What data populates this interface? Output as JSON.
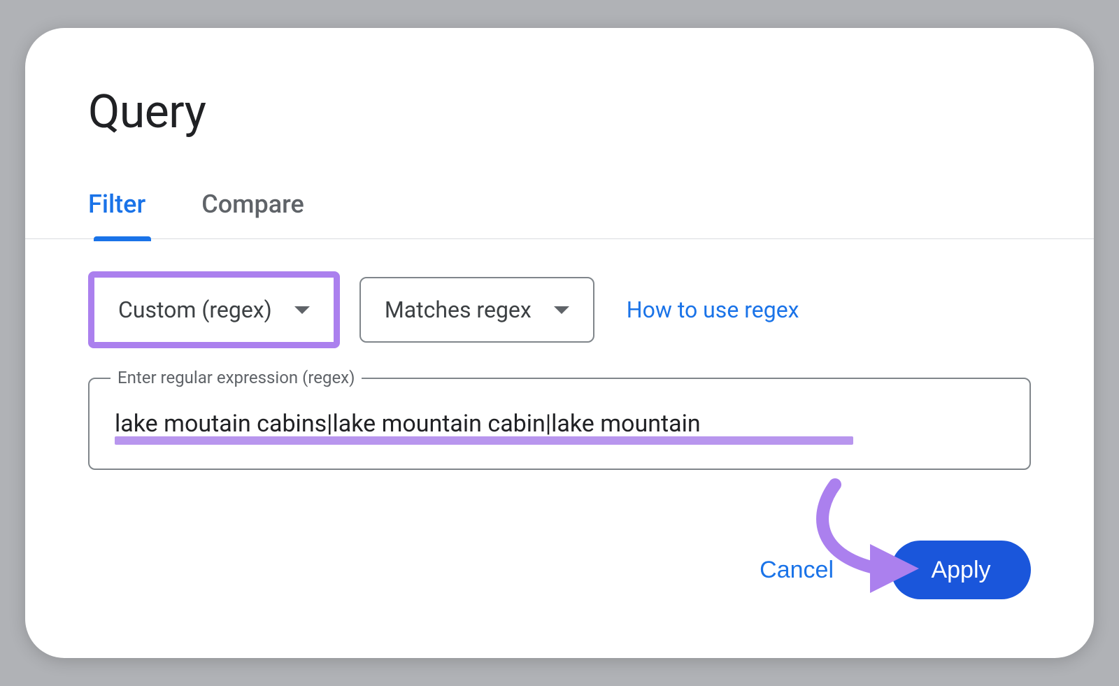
{
  "dialog": {
    "title": "Query"
  },
  "tabs": {
    "filter": "Filter",
    "compare": "Compare"
  },
  "controls": {
    "type_dropdown": "Custom (regex)",
    "match_dropdown": "Matches regex",
    "help_link": "How to use regex"
  },
  "field": {
    "legend": "Enter regular expression (regex)",
    "value": "lake moutain cabins|lake mountain cabin|lake mountain"
  },
  "actions": {
    "cancel": "Cancel",
    "apply": "Apply"
  },
  "colors": {
    "accent": "#1a73e8",
    "primary_button": "#1a56db",
    "annotation": "#ab80ee"
  }
}
